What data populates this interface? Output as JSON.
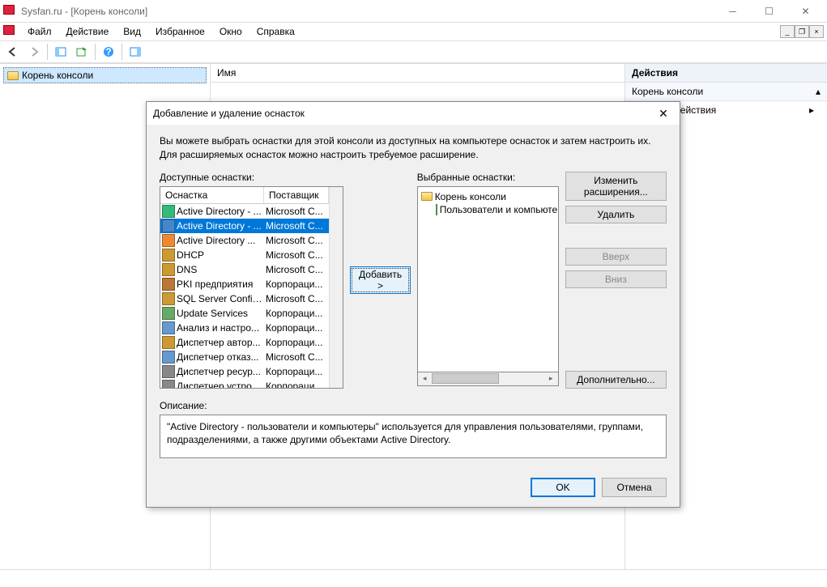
{
  "window": {
    "title": "Sysfan.ru - [Корень консоли]"
  },
  "menu": {
    "file": "Файл",
    "action": "Действие",
    "view": "Вид",
    "favorites": "Избранное",
    "window": "Окно",
    "help": "Справка"
  },
  "tree": {
    "root": "Корень консоли"
  },
  "center": {
    "name_header": "Имя"
  },
  "actions": {
    "header": "Действия",
    "sub": "Корень консоли",
    "more": "ельные действия"
  },
  "dialog": {
    "title": "Добавление и удаление оснасток",
    "intro": "Вы можете выбрать оснастки для этой консоли из доступных на компьютере оснасток и затем настроить их. Для расширяемых оснасток можно настроить требуемое расширение.",
    "available_label": "Доступные оснастки:",
    "selected_label": "Выбранные оснастки:",
    "col_snapin": "Оснастка",
    "col_vendor": "Поставщик",
    "add_btn": "Добавить >",
    "edit_ext": "Изменить расширения...",
    "remove": "Удалить",
    "up": "Вверх",
    "down": "Вниз",
    "advanced": "Дополнительно...",
    "desc_label": "Описание:",
    "desc_text": "\"Active Directory - пользователи и компьютеры\" используется для управления пользователями, группами, подразделениями, а также другими объектами Active Directory.",
    "ok": "OK",
    "cancel": "Отмена",
    "snapins": [
      {
        "name": "Active Directory - ...",
        "vendor": "Microsoft C...",
        "sel": false,
        "color": "#3b7"
      },
      {
        "name": "Active Directory - ...",
        "vendor": "Microsoft C...",
        "sel": true,
        "color": "#48c"
      },
      {
        "name": "Active Directory ...",
        "vendor": "Microsoft C...",
        "sel": false,
        "color": "#e83"
      },
      {
        "name": "DHCP",
        "vendor": "Microsoft C...",
        "sel": false,
        "color": "#c93"
      },
      {
        "name": "DNS",
        "vendor": "Microsoft C...",
        "sel": false,
        "color": "#c93"
      },
      {
        "name": "PKI предприятия",
        "vendor": "Корпораци...",
        "sel": false,
        "color": "#b73"
      },
      {
        "name": "SQL Server Config...",
        "vendor": "Microsoft C...",
        "sel": false,
        "color": "#c93"
      },
      {
        "name": "Update Services",
        "vendor": "Корпораци...",
        "sel": false,
        "color": "#6a6"
      },
      {
        "name": "Анализ и настро...",
        "vendor": "Корпораци...",
        "sel": false,
        "color": "#69c"
      },
      {
        "name": "Диспетчер автор...",
        "vendor": "Корпораци...",
        "sel": false,
        "color": "#c93"
      },
      {
        "name": "Диспетчер отказ...",
        "vendor": "Microsoft C...",
        "sel": false,
        "color": "#69c"
      },
      {
        "name": "Диспетчер ресур...",
        "vendor": "Корпораци...",
        "sel": false,
        "color": "#888"
      },
      {
        "name": "Диспетчер устро...",
        "vendor": "Корпораци...",
        "sel": false,
        "color": "#888"
      }
    ],
    "selected_tree": {
      "root": "Корень консоли",
      "child": "Пользователи и компьютеры"
    }
  }
}
